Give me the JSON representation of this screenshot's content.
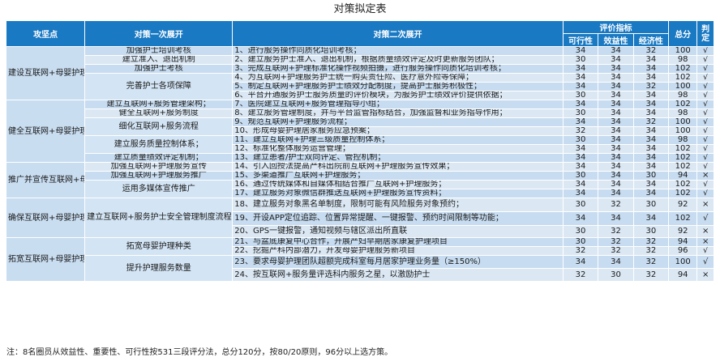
{
  "title": "对策拟定表",
  "headers": {
    "target": "攻坚点",
    "first": "对策一次展开",
    "second": "对策二次展开",
    "eval": "评价指标",
    "feasibility": "可行性",
    "benefit": "效益性",
    "economy": "经济性",
    "total": "总分",
    "judge": "判定"
  },
  "groups": [
    "建设互联网+母婴护理职业化团队",
    "健全互联网+母婴护理服务制度流程",
    "推广并宣传互联网+母婴护理服务",
    "确保互联网+母婴护理服务职业安全",
    "拓宽互联网+母婴护理服务种类数量"
  ],
  "first_items": [
    "加强护士培训考核",
    "建立准入、退出机制",
    "加强护士考核",
    "完善护士各项保障",
    "建立互联网+服务管理架构；",
    "健全互联网+服务制度",
    "细化互联网+服务流程",
    "建立服务质量控制体系；",
    "建立质量绩效评定机制；",
    "加强互联网+护理服务宣传",
    "加强互联网+护理服务推广",
    "运用多媒体宣传推广",
    "建立互联网+服务护士安全管理制度流程",
    "拓宽母婴护理种类",
    "提升护理服务数量"
  ],
  "rows": [
    {
      "text": "1、进行服务操作同质化培训考核；",
      "f": "34",
      "b": "34",
      "e": "32",
      "t": "100",
      "j": "√"
    },
    {
      "text": "2、建立服务护士准入、退出机制，根据质量绩效评定及时更新服务团队；",
      "f": "30",
      "b": "34",
      "e": "34",
      "t": "98",
      "j": "√"
    },
    {
      "text": "3、完成互联网+护理标准化操作视频拍摄，进行服务操作同质化培训考核；",
      "f": "34",
      "b": "34",
      "e": "34",
      "t": "102",
      "j": "√"
    },
    {
      "text": "4、为互联网+护理服务护士统一购买责任险、医疗意外险等保障；",
      "f": "34",
      "b": "34",
      "e": "34",
      "t": "102",
      "j": "√"
    },
    {
      "text": "5、制定互联网+护理服务护士绩效分配制度，提高护士服务积极性；",
      "f": "34",
      "b": "34",
      "e": "32",
      "t": "100",
      "j": "√"
    },
    {
      "text": "6、平台开通服务护士服务质量的评价模块，为服务护士绩效评价提供依据；",
      "f": "30",
      "b": "34",
      "e": "34",
      "t": "98",
      "j": "√"
    },
    {
      "text": "7、医院建立互联网+服务管理指导小组；",
      "f": "34",
      "b": "34",
      "e": "34",
      "t": "102",
      "j": "√"
    },
    {
      "text": "8、建立服务管理制度，并与平台监管指标结合，加强监督和业务指导作用；",
      "f": "30",
      "b": "34",
      "e": "34",
      "t": "98",
      "j": "√"
    },
    {
      "text": "9、规范互联网+护理服务流程；",
      "f": "34",
      "b": "34",
      "e": "32",
      "t": "100",
      "j": "√"
    },
    {
      "text": "10、形成母婴护理居家服务应急预案；",
      "f": "32",
      "b": "34",
      "e": "34",
      "t": "100",
      "j": "√"
    },
    {
      "text": "11、建立互联网+护理三级质量控制体系；",
      "f": "30",
      "b": "34",
      "e": "34",
      "t": "98",
      "j": "√"
    },
    {
      "text": "12、标准化整体服务运营管理；",
      "f": "34",
      "b": "34",
      "e": "34",
      "t": "102",
      "j": "√"
    },
    {
      "text": "13、建立患者/护士双向评定、管控机制；",
      "f": "34",
      "b": "34",
      "e": "34",
      "t": "102",
      "j": "√"
    },
    {
      "text": "14、引入回授法提高产科出院前互联网+护理服务宣传效果；",
      "f": "34",
      "b": "34",
      "e": "34",
      "t": "102",
      "j": "√"
    },
    {
      "text": "15、多渠道推广互联网+护理服务；",
      "f": "30",
      "b": "34",
      "e": "30",
      "t": "94",
      "j": "×"
    },
    {
      "text": "16、通过传统媒体和自媒体相结合推广互联网+护理服务；",
      "f": "34",
      "b": "34",
      "e": "34",
      "t": "102",
      "j": "√"
    },
    {
      "text": "17、建立服务对象微信群推送互联网+护理服务宣传资料；",
      "f": "34",
      "b": "34",
      "e": "34",
      "t": "102",
      "j": "√"
    },
    {
      "text": "18、建立服务对象黑名单制度，限制可能有风险服务对象预约；",
      "f": "30",
      "b": "32",
      "e": "30",
      "t": "92",
      "j": "×"
    },
    {
      "text": "19、开设APP定位追踪、位置异常提醒、一键报警、预约时间限制等功能；",
      "f": "34",
      "b": "34",
      "e": "34",
      "t": "102",
      "j": "√"
    },
    {
      "text": "20、GPS一键报警，通知视频与辖区派出所直联",
      "f": "30",
      "b": "32",
      "e": "30",
      "t": "92",
      "j": "×"
    },
    {
      "text": "21、与盆底康复中心合作，开展产妇早期居家康复护理项目",
      "f": "30",
      "b": "32",
      "e": "32",
      "t": "94",
      "j": "×"
    },
    {
      "text": "22、挖掘产科内部潜力，开发母婴护理服务新项目",
      "f": "32",
      "b": "32",
      "e": "32",
      "t": "96",
      "j": "√"
    },
    {
      "text": "23、要求母婴护理团队超额完成科室每月居家护理业务量（≥150%）",
      "f": "34",
      "b": "34",
      "e": "32",
      "t": "100",
      "j": "√"
    },
    {
      "text": "24、按互联网+服务量评选科内服务之星，以激励护士",
      "f": "32",
      "b": "30",
      "e": "32",
      "t": "94",
      "j": "×"
    }
  ],
  "note": "注：8名圈员从效益性、重要性、可行性按531三段评分法，总分120分，按80/20原则，96分以上选方策。"
}
